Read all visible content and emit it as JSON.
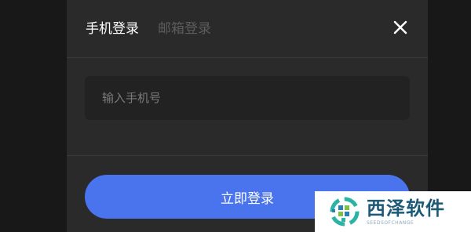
{
  "tabs": [
    {
      "label": "手机登录",
      "active": true
    },
    {
      "label": "邮箱登录",
      "active": false
    }
  ],
  "close": {
    "icon": "close-icon"
  },
  "phone_input": {
    "placeholder": "输入手机号",
    "value": ""
  },
  "login_button": {
    "label": "立即登录"
  },
  "watermark": {
    "title": "西泽软件",
    "subtitle": "SEEDSOFCHANGE"
  },
  "colors": {
    "modal_bg": "#2a2a2a",
    "backdrop": "#181818",
    "input_bg": "#222222",
    "accent": "#4a74ee",
    "tab_active": "#ffffff",
    "tab_inactive": "#5c5c5c"
  }
}
